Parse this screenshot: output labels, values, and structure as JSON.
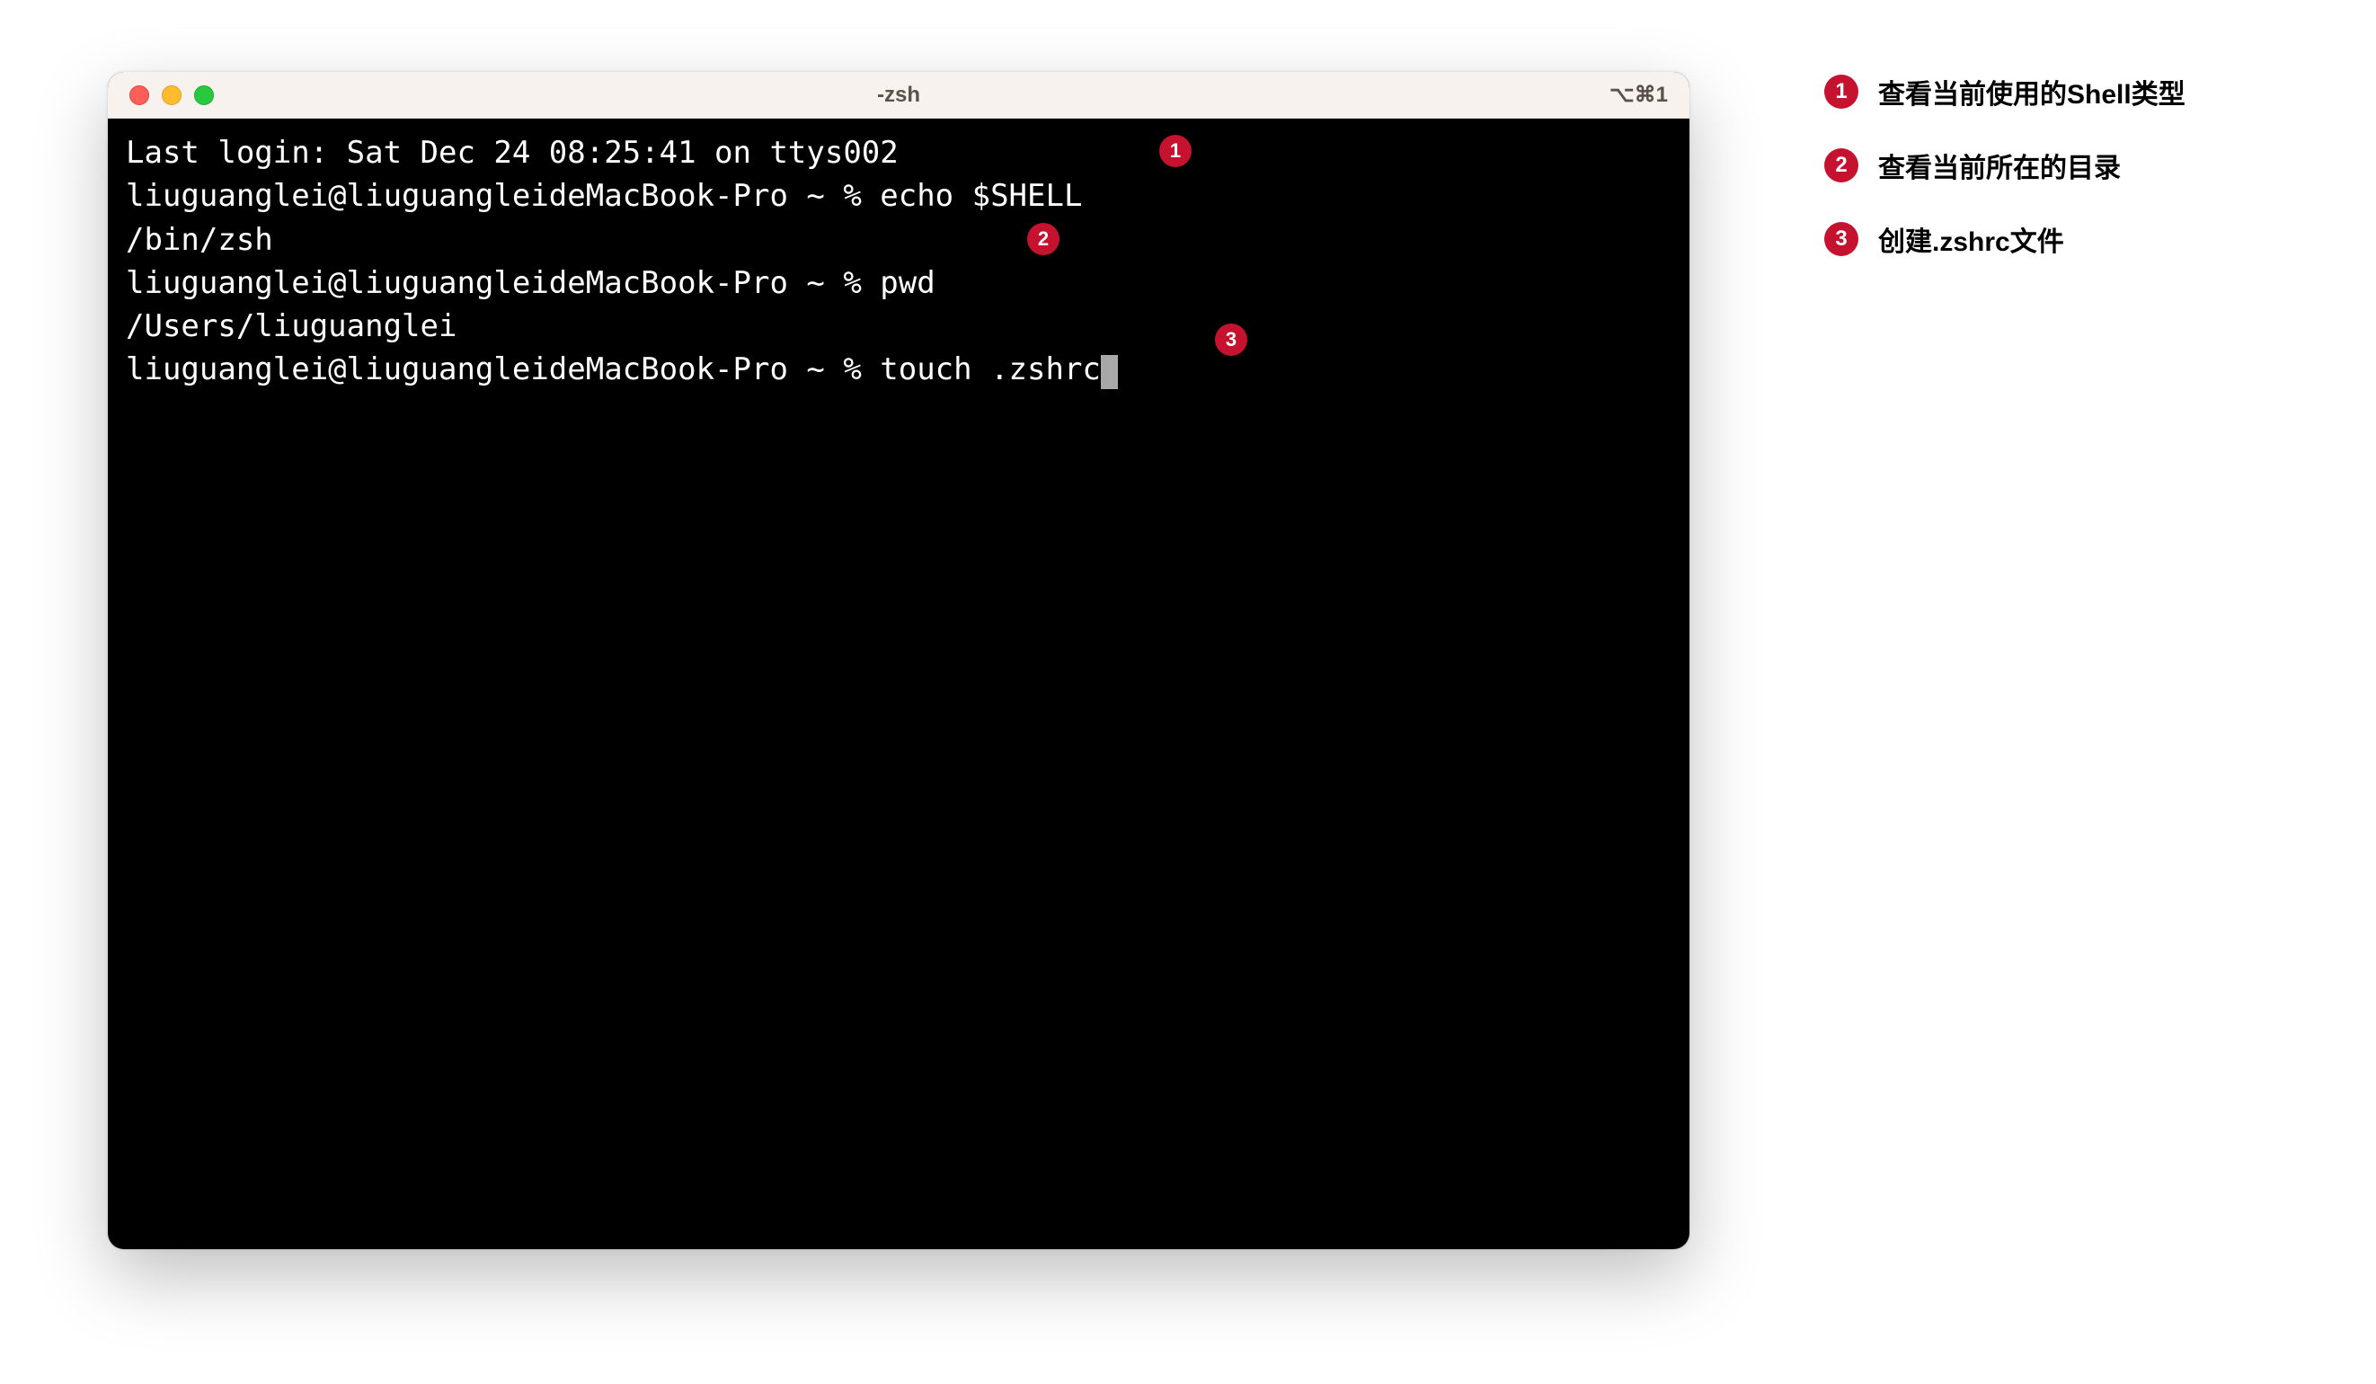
{
  "window": {
    "title": "-zsh",
    "shortcut": "⌥⌘1"
  },
  "terminal": {
    "lines": {
      "login": "Last login: Sat Dec 24 08:25:41 on ttys002",
      "prompt1": "liuguanglei@liuguangleideMacBook-Pro ~ % echo $SHELL",
      "output1": "/bin/zsh",
      "prompt2": "liuguanglei@liuguangleideMacBook-Pro ~ % pwd",
      "output2": "/Users/liuguanglei",
      "prompt3": "liuguanglei@liuguangleideMacBook-Pro ~ % touch .zshrc"
    }
  },
  "callouts": {
    "b1": "1",
    "b2": "2",
    "b3": "3"
  },
  "legend": {
    "items": [
      {
        "num": "1",
        "text": "查看当前使用的Shell类型"
      },
      {
        "num": "2",
        "text": "查看当前所在的目录"
      },
      {
        "num": "3",
        "text": "创建.zshrc文件"
      }
    ]
  }
}
